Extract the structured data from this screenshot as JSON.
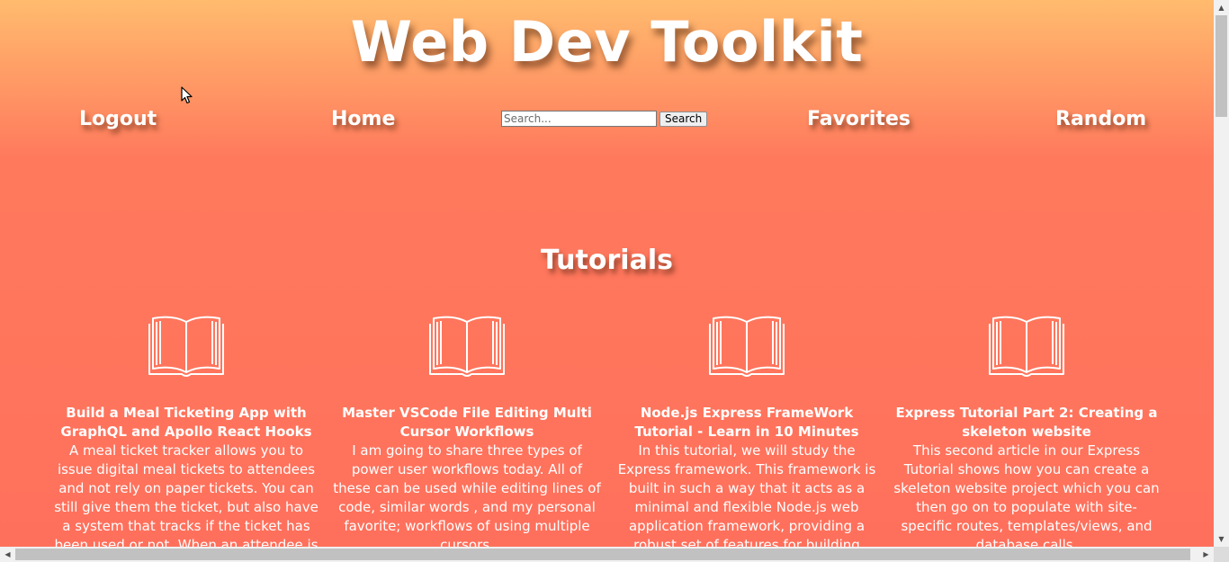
{
  "header": {
    "title": "Web Dev Toolkit"
  },
  "nav": {
    "logout": "Logout",
    "home": "Home",
    "favorites": "Favorites",
    "random": "Random"
  },
  "search": {
    "placeholder": "Search...",
    "value": "",
    "button_label": "Search"
  },
  "section": {
    "heading": "Tutorials"
  },
  "cards": [
    {
      "icon": "open-book-icon",
      "title": "Build a Meal Ticketing App with GraphQL and Apollo React Hooks",
      "description": "A meal ticket tracker allows you to issue digital meal tickets to attendees and not rely on paper tickets. You can still give them the ticket, but also have a system that tracks if the ticket has been used or not. When an attendee is served a meal,"
    },
    {
      "icon": "open-book-icon",
      "title": "Master VSCode File Editing Multi Cursor Workflows",
      "description": "I am going to share three types of power user workflows today. All of these can be used while editing lines of code, similar words , and my personal favorite; workflows of using multiple cursors."
    },
    {
      "icon": "open-book-icon",
      "title": "Node.js Express FrameWork Tutorial - Learn in 10 Minutes",
      "description": "In this tutorial, we will study the Express framework. This framework is built in such a way that it acts as a minimal and flexible Node.js web application framework, providing a robust set of features for building single and"
    },
    {
      "icon": "open-book-icon",
      "title": "Express Tutorial Part 2: Creating a skeleton website",
      "description": "This second article in our Express Tutorial shows how you can create a skeleton website project which you can then go on to populate with site-specific routes, templates/views, and database calls."
    }
  ],
  "colors": {
    "gradient_top": "#ffbb6e",
    "gradient_bottom": "#ff705c",
    "text": "#ffffff"
  }
}
